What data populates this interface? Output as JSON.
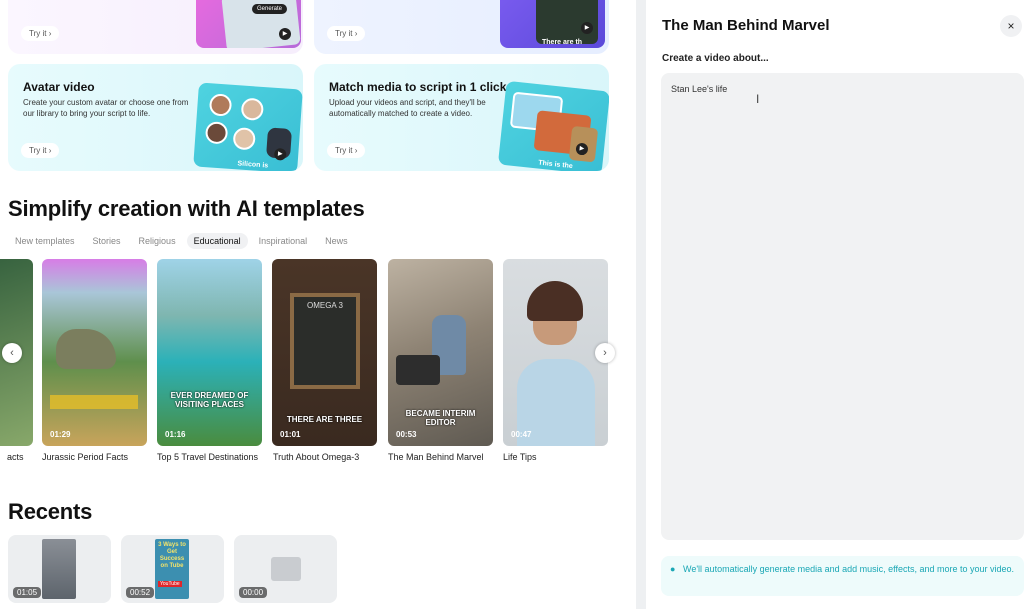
{
  "feature_cards": [
    {
      "title": "",
      "description": "",
      "try_label": "Try it"
    },
    {
      "title": "",
      "description": "",
      "try_label": "Try it"
    },
    {
      "title": "Avatar video",
      "description": "Create your custom avatar or choose one from our library to bring your script to life.",
      "try_label": "Try it"
    },
    {
      "title": "Match media to script in 1 click",
      "description": "Upload your videos and script, and they'll be automatically matched to create a video.",
      "try_label": "Try it"
    }
  ],
  "card_overlay_texts": {
    "generate_chip": "Generate",
    "avatar_caption": "Silicon is",
    "match_caption": "This is the",
    "top_caption": "There are th"
  },
  "templates_section": {
    "title": "Simplify creation with AI templates",
    "tabs": [
      {
        "label": "New templates",
        "active": false
      },
      {
        "label": "Stories",
        "active": false
      },
      {
        "label": "Religious",
        "active": false
      },
      {
        "label": "Educational",
        "active": true
      },
      {
        "label": "Inspirational",
        "active": false
      },
      {
        "label": "News",
        "active": false
      }
    ],
    "items": [
      {
        "label": "acts",
        "duration": "",
        "caption": ""
      },
      {
        "label": "Jurassic Period Facts",
        "duration": "01:29",
        "caption": ""
      },
      {
        "label": "Top 5 Travel Destinations",
        "duration": "01:16",
        "caption": "EVER DREAMED OF VISITING PLACES"
      },
      {
        "label": "Truth About Omega-3",
        "duration": "01:01",
        "caption": "THERE ARE THREE"
      },
      {
        "label": "The Man Behind Marvel",
        "duration": "00:53",
        "caption": "BECAME INTERIM EDITOR"
      },
      {
        "label": "Life Tips",
        "duration": "00:47",
        "caption": ""
      }
    ],
    "chalkboard_title": "OMEGA 3",
    "prev_arrow": "‹",
    "next_arrow": "›"
  },
  "recents": {
    "title": "Recents",
    "items": [
      {
        "duration": "01:05"
      },
      {
        "duration": "00:52",
        "thumb_text": "3 Ways to Get Success on Tube",
        "thumb_brand": "YouTube"
      },
      {
        "duration": "00:00"
      }
    ]
  },
  "panel": {
    "title": "The Man Behind Marvel",
    "close_icon": "×",
    "prompt_label": "Create a video about...",
    "prompt_value": "Stan Lee's life",
    "info_text": "We'll automatically generate media and add music, effects, and more to your video."
  },
  "colors": {
    "accent": "#1aa7b5",
    "panel_bg": "#f1f2f3",
    "info_bg": "#eefbfb"
  }
}
